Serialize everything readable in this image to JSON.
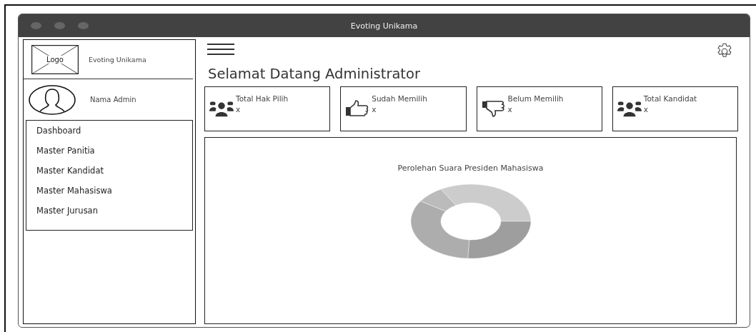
{
  "window": {
    "title": "Evoting Unikama"
  },
  "sidebar": {
    "logo": "Logo",
    "app_name": "Evoting Unikama",
    "user_name": "Nama Admin",
    "menu": [
      "Dashboard",
      "Master Panitia",
      "Master Kandidat",
      "Master Mahasiswa",
      "Master Jurusan"
    ]
  },
  "heading": "Selamat Datang Administrator",
  "stats": [
    {
      "kind": "group",
      "label": "Total Hak Pilih",
      "value": "x"
    },
    {
      "kind": "thumbs-up",
      "label": "Sudah Memilih",
      "value": "x"
    },
    {
      "kind": "thumbs-down",
      "label": "Belum Memilih",
      "value": "x"
    },
    {
      "kind": "group",
      "label": "Total Kandidat",
      "value": "x"
    }
  ],
  "chart": {
    "title": "Perolehan Suara Presiden Mahasiswa"
  }
}
